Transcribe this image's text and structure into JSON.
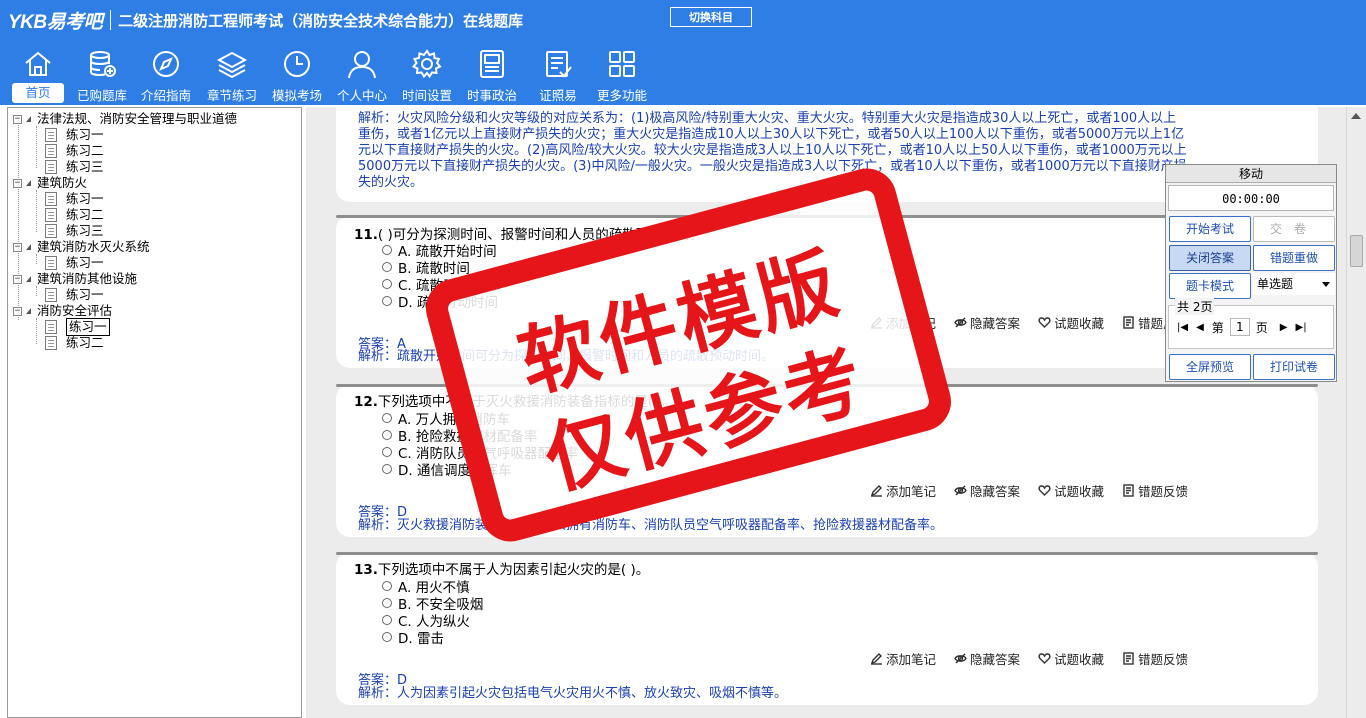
{
  "header": {
    "logo": "YKB易考吧",
    "title": "二级注册消防工程师考试（消防安全技术综合能力）在线题库",
    "switch_subject": "切换科目"
  },
  "nav": [
    {
      "label": "首页",
      "icon": "home-icon"
    },
    {
      "label": "已购题库",
      "icon": "database-icon"
    },
    {
      "label": "介绍指南",
      "icon": "compass-icon"
    },
    {
      "label": "章节练习",
      "icon": "layers-icon"
    },
    {
      "label": "模拟考场",
      "icon": "clock-icon"
    },
    {
      "label": "个人中心",
      "icon": "user-icon"
    },
    {
      "label": "时间设置",
      "icon": "gear-icon"
    },
    {
      "label": "时事政治",
      "icon": "news-icon"
    },
    {
      "label": "证照易",
      "icon": "certificate-icon"
    },
    {
      "label": "更多功能",
      "icon": "grid-icon"
    }
  ],
  "tree": [
    {
      "label": "法律法规、消防安全管理与职业道德",
      "children": [
        "练习一",
        "练习二",
        "练习三"
      ]
    },
    {
      "label": "建筑防火",
      "children": [
        "练习一",
        "练习二",
        "练习三"
      ]
    },
    {
      "label": "建筑消防水灭火系统",
      "children": [
        "练习一"
      ]
    },
    {
      "label": "建筑消防其他设施",
      "children": [
        "练习一"
      ]
    },
    {
      "label": "消防安全评估",
      "children": [
        "练习一",
        "练习二"
      ]
    }
  ],
  "actions": {
    "note": "添加笔记",
    "hide": "隐藏答案",
    "fav": "试题收藏",
    "report": "错题反馈"
  },
  "prev_analysis": {
    "lines": [
      "解析：火灾风险分级和火灾等级的对应关系为：(1)极高风险/特别重大火灾、重大火灾。特别重大火灾是指造成30人以上死亡，或者100人以上",
      "重伤，或者1亿元以上直接财产损失的火灾；重大火灾是指造成10人以上30人以下死亡，或者50人以上100人以下重伤，或者5000万元以上1亿",
      "元以下直接财产损失的火灾。(2)高风险/较大火灾。较大火灾是指造成3人以上10人以下死亡，或者10人以上50人以下重伤，或者1000万元以上",
      "5000万元以下直接财产损失的火灾。(3)中风险/一般火灾。一般火灾是指造成3人以下死亡，或者10人以下重伤，或者1000万元以下直接财产损",
      "失的火灾。"
    ]
  },
  "questions": [
    {
      "num": "11.",
      "text": "(  )可分为探测时间、报警时间和人员的疏散预动时间。",
      "options": [
        "A. 疏散开始时间",
        "B. 疏散时间",
        "C. 疏散动作时间",
        "D. 疏散行动时间"
      ],
      "answer": "答案：A",
      "analysis": "解析：疏散开始时间可分为探测时间、报警时间和人员的疏散预动时间。"
    },
    {
      "num": "12.",
      "text": "下列选项中不属于灭火救援消防装备指标的是(  )。",
      "options": [
        "A. 万人拥有消防车",
        "B. 抢险救援器材配备率",
        "C. 消防队员空气呼吸器配备率",
        "D. 通信调度指挥车"
      ],
      "answer": "答案：D",
      "analysis": "解析：灭火救援消防装备包括：万人拥有消防车、消防队员空气呼吸器配备率、抢险救援器材配备率。"
    },
    {
      "num": "13.",
      "text": "下列选项中不属于人为因素引起火灾的是(  )。",
      "options": [
        "A. 用火不慎",
        "B. 不安全吸烟",
        "C. 人为纵火",
        "D. 雷击"
      ],
      "answer": "答案：D",
      "analysis": "解析：人为因素引起火灾包括电气火灾用火不慎、放火致灾、吸烟不慎等。"
    }
  ],
  "panel": {
    "title": "移动",
    "timer": "00:00:00",
    "start_exam": "开始考试",
    "submit": "交卷",
    "close_answer": "关闭答案",
    "redo_wrong": "错题重做",
    "card_mode": "题卡模式",
    "type_select": "单选题",
    "total_pages": "共 2页",
    "page_prefix": "第",
    "page_value": "1",
    "page_suffix": "页",
    "fullscreen": "全屏预览",
    "print": "打印试卷"
  },
  "watermark": {
    "line1": "软件模版",
    "line2": "仅供参考"
  },
  "colors": {
    "header": "#2f7ee6",
    "analysis_text": "#1b3fb0",
    "stamp": "#e5151a"
  }
}
